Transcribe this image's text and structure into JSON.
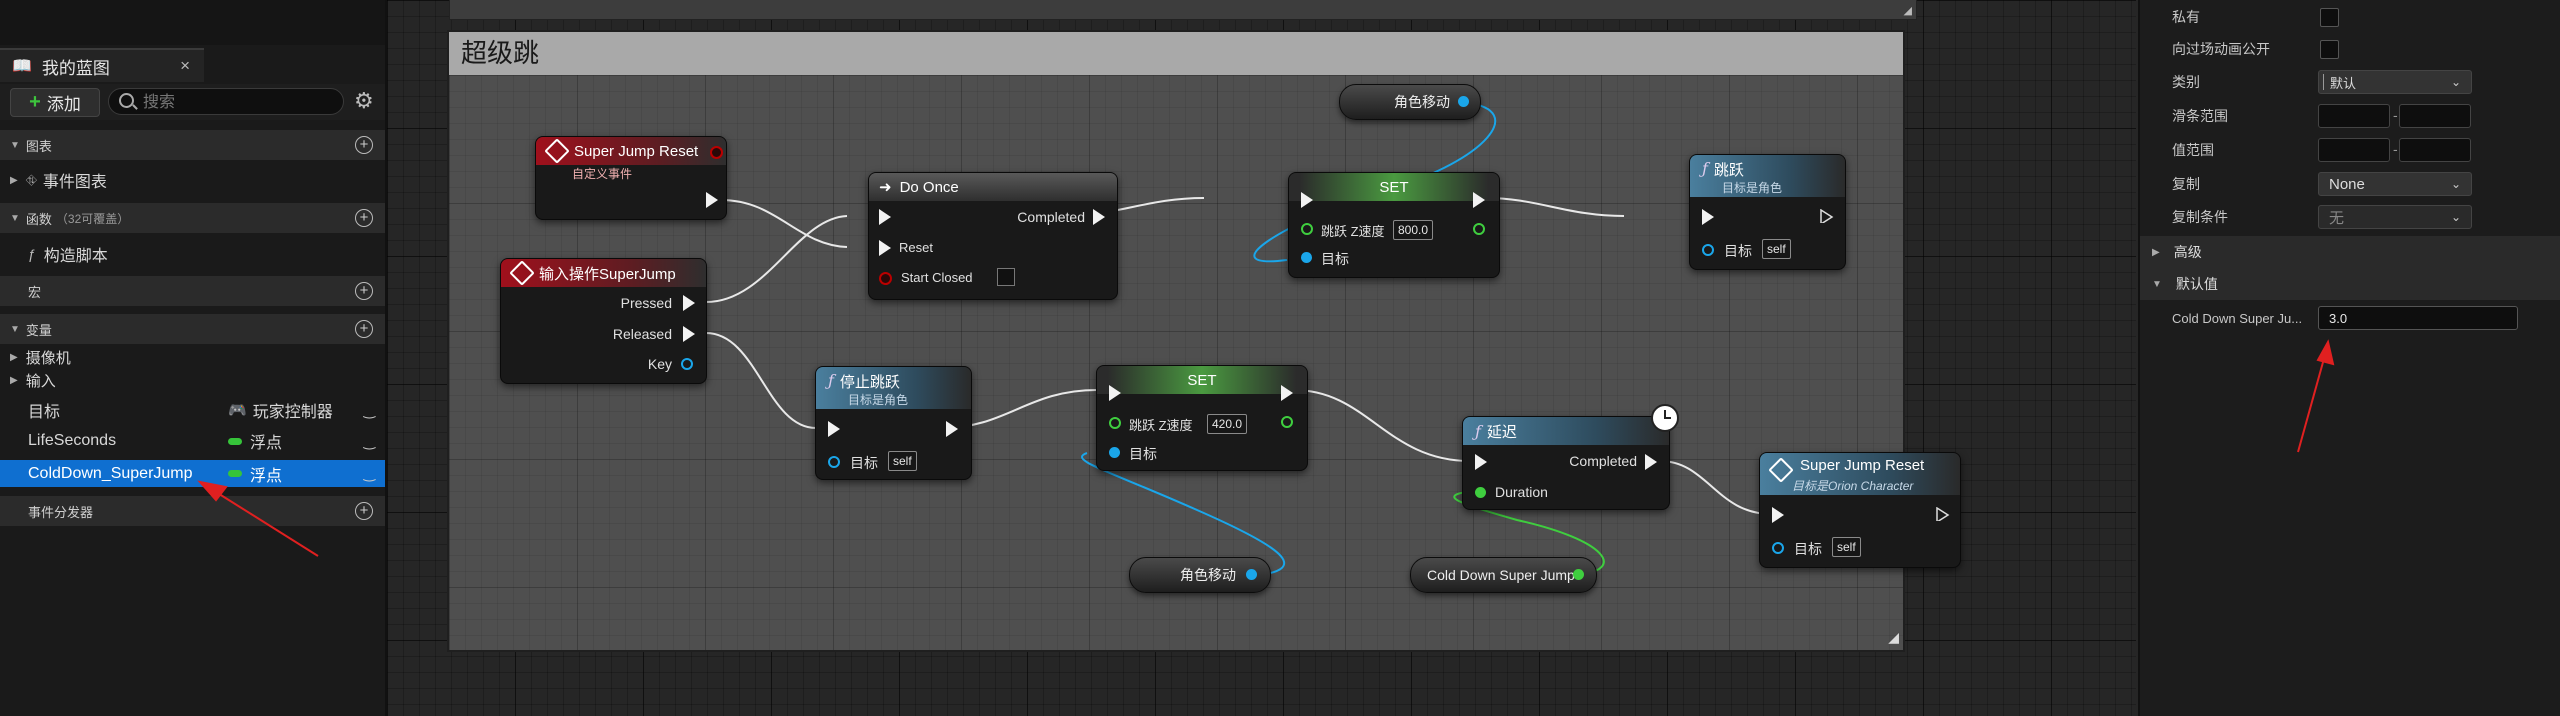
{
  "left_panel": {
    "tab_title": "我的蓝图",
    "tab_close": "×",
    "add_label": "添加",
    "search_placeholder": "搜索",
    "sections": {
      "graphs": "图表",
      "event_graph": "事件图表",
      "functions": "函数",
      "functions_count": "（32可覆盖）",
      "construction_script": "构造脚本",
      "macros": "宏",
      "variables": "变量",
      "event_dispatchers": "事件分发器"
    },
    "categories": [
      "摄像机",
      "输入"
    ],
    "variables": [
      {
        "name": "目标",
        "type": "玩家控制器",
        "selected": false
      },
      {
        "name": "LifeSeconds",
        "type": "浮点",
        "selected": false
      },
      {
        "name": "ColdDown_SuperJump",
        "type": "浮点",
        "selected": true
      }
    ]
  },
  "graph": {
    "comment_title": "超级跳",
    "nodes": {
      "super_jump_reset_event": {
        "title": "Super Jump Reset",
        "subtitle": "自定义事件"
      },
      "input_action": {
        "title": "输入操作SuperJump",
        "pins": [
          "Pressed",
          "Released",
          "Key"
        ]
      },
      "do_once": {
        "title": "Do Once",
        "pins": [
          "Completed",
          "Reset",
          "Start Closed"
        ]
      },
      "set_top": {
        "title": "SET",
        "pin_label": "跳跃 Z速度",
        "value": "800.0",
        "target": "目标"
      },
      "jump": {
        "title": "跳跃",
        "subtitle": "目标是角色",
        "target": "目标",
        "self": "self"
      },
      "stop_jump": {
        "title": "停止跳跃",
        "subtitle": "目标是角色",
        "target": "目标",
        "self": "self"
      },
      "set_bottom": {
        "title": "SET",
        "pin_label": "跳跃 Z速度",
        "value": "420.0",
        "target": "目标"
      },
      "delay": {
        "title": "延迟",
        "pins": [
          "Completed",
          "Duration"
        ]
      },
      "super_jump_reset_call": {
        "title": "Super Jump Reset",
        "subtitle": "目标是Orion Character",
        "target": "目标",
        "self": "self"
      }
    },
    "getters": {
      "char_move_top": "角色移动",
      "char_move_bottom": "角色移动",
      "cold_down": "Cold Down Super Jump"
    }
  },
  "details_panel": {
    "props": {
      "private": "私有",
      "expose_cinematics": "向过场动画公开",
      "category": "类别",
      "category_value": "默认",
      "slider_range": "滑条范围",
      "value_range": "值范围",
      "replication": "复制",
      "replication_value": "None",
      "replication_condition": "复制条件",
      "replication_condition_value": "无",
      "advanced": "高级",
      "default_value": "默认值",
      "default_field_label": "Cold Down Super Ju...",
      "default_field_value": "3.0"
    }
  },
  "colors": {
    "exec_wire": "#e8e8e8",
    "object_wire": "#1aa6ea",
    "float_wire": "#3fce3f",
    "selection": "#0f6fd0",
    "annotation_arrow": "#e02020"
  }
}
